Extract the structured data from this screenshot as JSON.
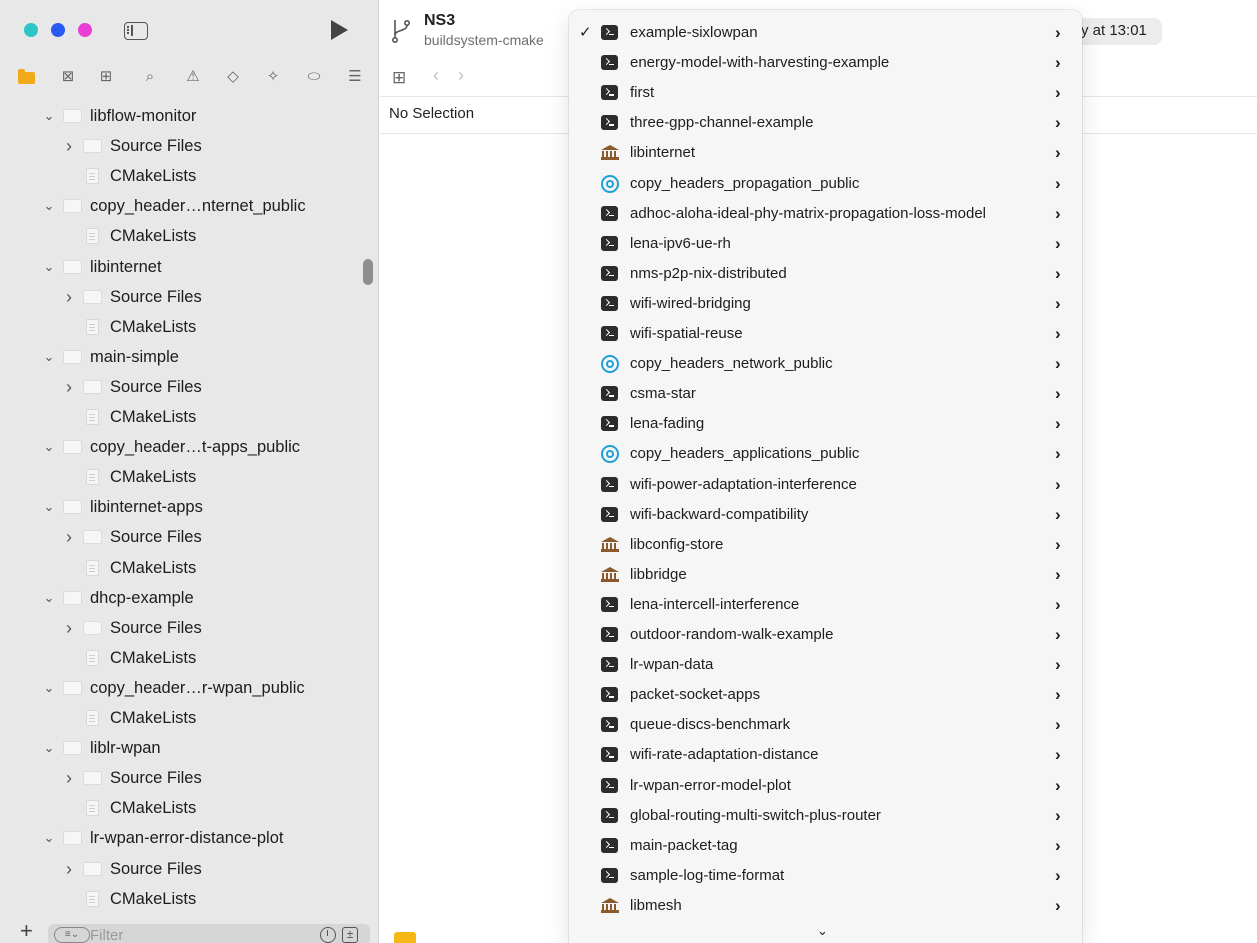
{
  "project": {
    "name": "NS3",
    "branch": "buildsystem-cmake"
  },
  "status": {
    "text": "y at 13:01"
  },
  "editor": {
    "no_selection": "No Selection"
  },
  "navigator": {
    "tabs": [
      "folder-icon",
      "source-control-icon",
      "symbol-icon",
      "search-icon",
      "warning-icon",
      "test-icon",
      "debug-icon",
      "breakpoint-icon",
      "report-icon"
    ],
    "tree": [
      {
        "label": "libflow-monitor",
        "type": "group",
        "expanded": true
      },
      {
        "label": "Source Files",
        "type": "subgroup",
        "expanded": false
      },
      {
        "label": "CMakeLists",
        "type": "file"
      },
      {
        "label": "copy_header…nternet_public",
        "type": "group",
        "expanded": true
      },
      {
        "label": "CMakeLists",
        "type": "file"
      },
      {
        "label": "libinternet",
        "type": "group",
        "expanded": true
      },
      {
        "label": "Source Files",
        "type": "subgroup",
        "expanded": false
      },
      {
        "label": "CMakeLists",
        "type": "file"
      },
      {
        "label": "main-simple",
        "type": "group",
        "expanded": true
      },
      {
        "label": "Source Files",
        "type": "subgroup",
        "expanded": false
      },
      {
        "label": "CMakeLists",
        "type": "file"
      },
      {
        "label": "copy_header…t-apps_public",
        "type": "group",
        "expanded": true
      },
      {
        "label": "CMakeLists",
        "type": "file"
      },
      {
        "label": "libinternet-apps",
        "type": "group",
        "expanded": true
      },
      {
        "label": "Source Files",
        "type": "subgroup",
        "expanded": false
      },
      {
        "label": "CMakeLists",
        "type": "file"
      },
      {
        "label": "dhcp-example",
        "type": "group",
        "expanded": true
      },
      {
        "label": "Source Files",
        "type": "subgroup",
        "expanded": false
      },
      {
        "label": "CMakeLists",
        "type": "file"
      },
      {
        "label": "copy_header…r-wpan_public",
        "type": "group",
        "expanded": true
      },
      {
        "label": "CMakeLists",
        "type": "file"
      },
      {
        "label": "liblr-wpan",
        "type": "group",
        "expanded": true
      },
      {
        "label": "Source Files",
        "type": "subgroup",
        "expanded": false
      },
      {
        "label": "CMakeLists",
        "type": "file"
      },
      {
        "label": "lr-wpan-error-distance-plot",
        "type": "group",
        "expanded": true
      },
      {
        "label": "Source Files",
        "type": "subgroup",
        "expanded": false
      },
      {
        "label": "CMakeLists",
        "type": "file"
      }
    ],
    "filter": {
      "placeholder": "Filter"
    }
  },
  "scheme_menu": {
    "items": [
      {
        "label": "example-sixlowpan",
        "icon": "terminal",
        "checked": true
      },
      {
        "label": "energy-model-with-harvesting-example",
        "icon": "terminal"
      },
      {
        "label": "first",
        "icon": "terminal"
      },
      {
        "label": "three-gpp-channel-example",
        "icon": "terminal"
      },
      {
        "label": "libinternet",
        "icon": "library"
      },
      {
        "label": "copy_headers_propagation_public",
        "icon": "target"
      },
      {
        "label": "adhoc-aloha-ideal-phy-matrix-propagation-loss-model",
        "icon": "terminal"
      },
      {
        "label": "lena-ipv6-ue-rh",
        "icon": "terminal"
      },
      {
        "label": "nms-p2p-nix-distributed",
        "icon": "terminal"
      },
      {
        "label": "wifi-wired-bridging",
        "icon": "terminal"
      },
      {
        "label": "wifi-spatial-reuse",
        "icon": "terminal"
      },
      {
        "label": "copy_headers_network_public",
        "icon": "target"
      },
      {
        "label": "csma-star",
        "icon": "terminal"
      },
      {
        "label": "lena-fading",
        "icon": "terminal"
      },
      {
        "label": "copy_headers_applications_public",
        "icon": "target"
      },
      {
        "label": "wifi-power-adaptation-interference",
        "icon": "terminal"
      },
      {
        "label": "wifi-backward-compatibility",
        "icon": "terminal"
      },
      {
        "label": "libconfig-store",
        "icon": "library"
      },
      {
        "label": "libbridge",
        "icon": "library"
      },
      {
        "label": "lena-intercell-interference",
        "icon": "terminal"
      },
      {
        "label": "outdoor-random-walk-example",
        "icon": "terminal"
      },
      {
        "label": "lr-wpan-data",
        "icon": "terminal"
      },
      {
        "label": "packet-socket-apps",
        "icon": "terminal"
      },
      {
        "label": "queue-discs-benchmark",
        "icon": "terminal"
      },
      {
        "label": "wifi-rate-adaptation-distance",
        "icon": "terminal"
      },
      {
        "label": "lr-wpan-error-model-plot",
        "icon": "terminal"
      },
      {
        "label": "global-routing-multi-switch-plus-router",
        "icon": "terminal"
      },
      {
        "label": "main-packet-tag",
        "icon": "terminal"
      },
      {
        "label": "sample-log-time-format",
        "icon": "terminal"
      },
      {
        "label": "libmesh",
        "icon": "library"
      }
    ]
  },
  "colors": {
    "traffic_1": "#2ec5c9",
    "traffic_2": "#2a5bf0",
    "traffic_3": "#ea3fd5",
    "folder_accent": "#f2a91a",
    "target_icon": "#1f9fd8",
    "library_icon": "#8a5a2b"
  }
}
